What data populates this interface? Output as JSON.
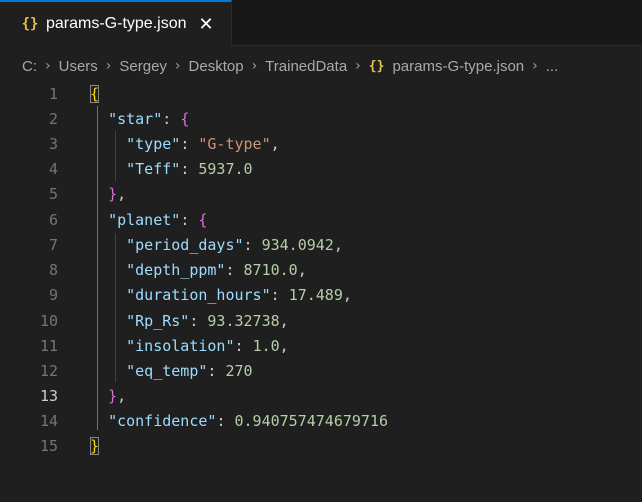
{
  "tab": {
    "icon": "{}",
    "label": "params-G-type.json",
    "close": "✕"
  },
  "breadcrumb": {
    "items": [
      "C:",
      "Users",
      "Sergey",
      "Desktop",
      "TrainedData"
    ],
    "file_icon": "{}",
    "file": "params-G-type.json",
    "ellipsis": "..."
  },
  "editor": {
    "active_line": 13,
    "lines": [
      {
        "n": "1"
      },
      {
        "n": "2"
      },
      {
        "n": "3"
      },
      {
        "n": "4"
      },
      {
        "n": "5"
      },
      {
        "n": "6"
      },
      {
        "n": "7"
      },
      {
        "n": "8"
      },
      {
        "n": "9"
      },
      {
        "n": "10"
      },
      {
        "n": "11"
      },
      {
        "n": "12"
      },
      {
        "n": "13"
      },
      {
        "n": "14"
      },
      {
        "n": "15"
      }
    ],
    "tokens": {
      "open_brace": "{",
      "star_key": "\"star\"",
      "colon": ": ",
      "comma": ",",
      "type_key": "\"type\"",
      "type_val": "\"G-type\"",
      "teff_key": "\"Teff\"",
      "teff_val": "5937.0",
      "close_brace_comma": "},",
      "planet_key": "\"planet\"",
      "period_key": "\"period_days\"",
      "period_val": "934.0942",
      "depth_key": "\"depth_ppm\"",
      "depth_val": "8710.0",
      "duration_key": "\"duration_hours\"",
      "duration_val": "17.489",
      "rprs_key": "\"Rp_Rs\"",
      "rprs_val": "93.32738",
      "insol_key": "\"insolation\"",
      "insol_val": "1.0",
      "eqtemp_key": "\"eq_temp\"",
      "eqtemp_val": "270",
      "conf_key": "\"confidence\"",
      "conf_val": "0.940757474679716",
      "close_brace": "}",
      "brace": "{",
      "closing_brace": "}"
    }
  },
  "colors": {
    "background": "#1f1f1f",
    "tab_accent": "#0078d4",
    "key": "#9cdcfe",
    "string": "#ce9178",
    "number": "#b5cea8",
    "bracket_level1": "#ffd700",
    "bracket_level2": "#da70d6"
  }
}
